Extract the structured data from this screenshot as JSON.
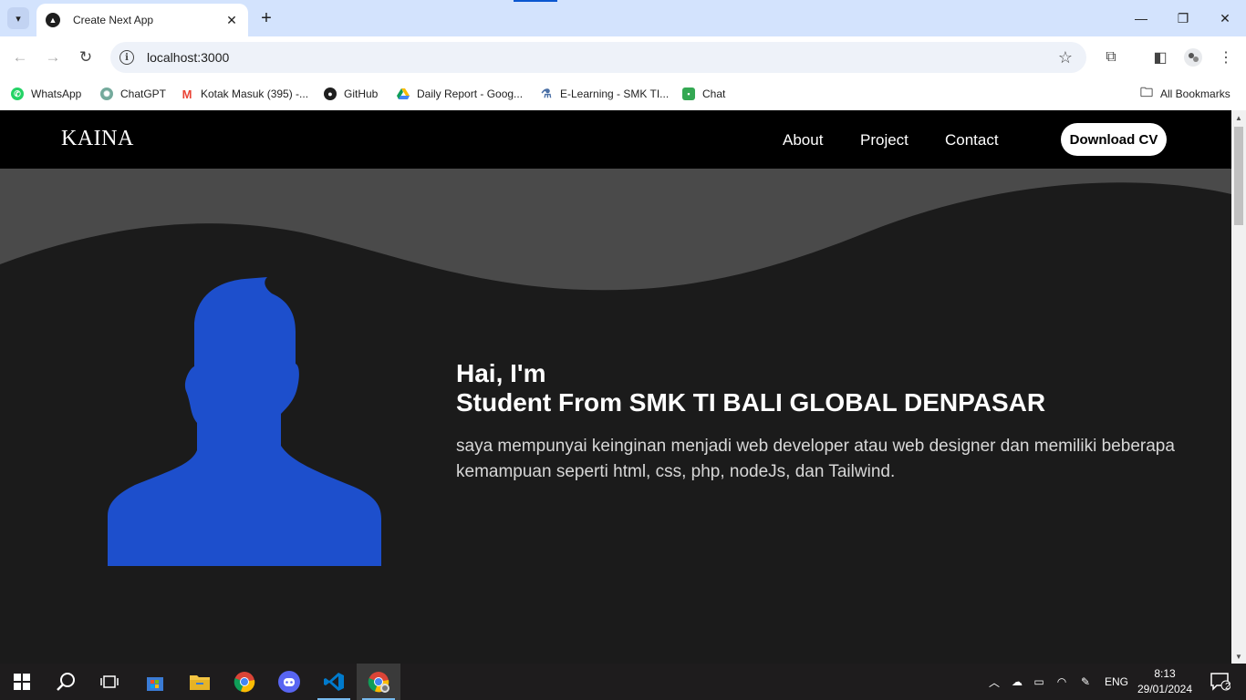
{
  "browser": {
    "tab_title": "Create Next App",
    "url": "localhost:3000",
    "bookmarks": [
      {
        "label": "WhatsApp",
        "icon": "whatsapp-icon",
        "color": "#25d366"
      },
      {
        "label": "ChatGPT",
        "icon": "chatgpt-icon",
        "color": "#74aa9c"
      },
      {
        "label": "Kotak Masuk (395) -...",
        "icon": "gmail-icon",
        "color": "#ea4335"
      },
      {
        "label": "GitHub",
        "icon": "github-icon",
        "color": "#1f1f1f"
      },
      {
        "label": "Daily Report - Goog...",
        "icon": "google-drive-icon",
        "color": "#fbbc04"
      },
      {
        "label": "E-Learning - SMK TI...",
        "icon": "elearning-icon",
        "color": "#4a6fa5"
      },
      {
        "label": "Chat",
        "icon": "google-chat-icon",
        "color": "#34a853"
      }
    ],
    "all_bookmarks_label": "All Bookmarks"
  },
  "site": {
    "logo": "KAINA",
    "nav": {
      "about": "About",
      "project": "Project",
      "contact": "Contact"
    },
    "download_cv": "Download CV",
    "hero": {
      "greeting": "Hai, I'm",
      "title": "Student From SMK TI BALI GLOBAL DENPASAR",
      "description": "saya mempunyai keinginan menjadi web developer atau web designer dan memiliki beberapa kemampuan seperti html, css, php, nodeJs, dan Tailwind."
    },
    "colors": {
      "nav_bg": "#000000",
      "body_bg": "#1b1b1b",
      "wave": "#4a4a4a",
      "avatar": "#1d4fcc"
    }
  },
  "taskbar": {
    "apps": [
      "start-icon",
      "search-icon",
      "task-view-icon",
      "microsoft-store-icon",
      "file-explorer-icon",
      "chrome-icon",
      "discord-icon",
      "vscode-icon",
      "chrome-profile-icon"
    ],
    "language": "ENG",
    "time": "8:13",
    "date": "29/01/2024",
    "notifications": "2"
  }
}
